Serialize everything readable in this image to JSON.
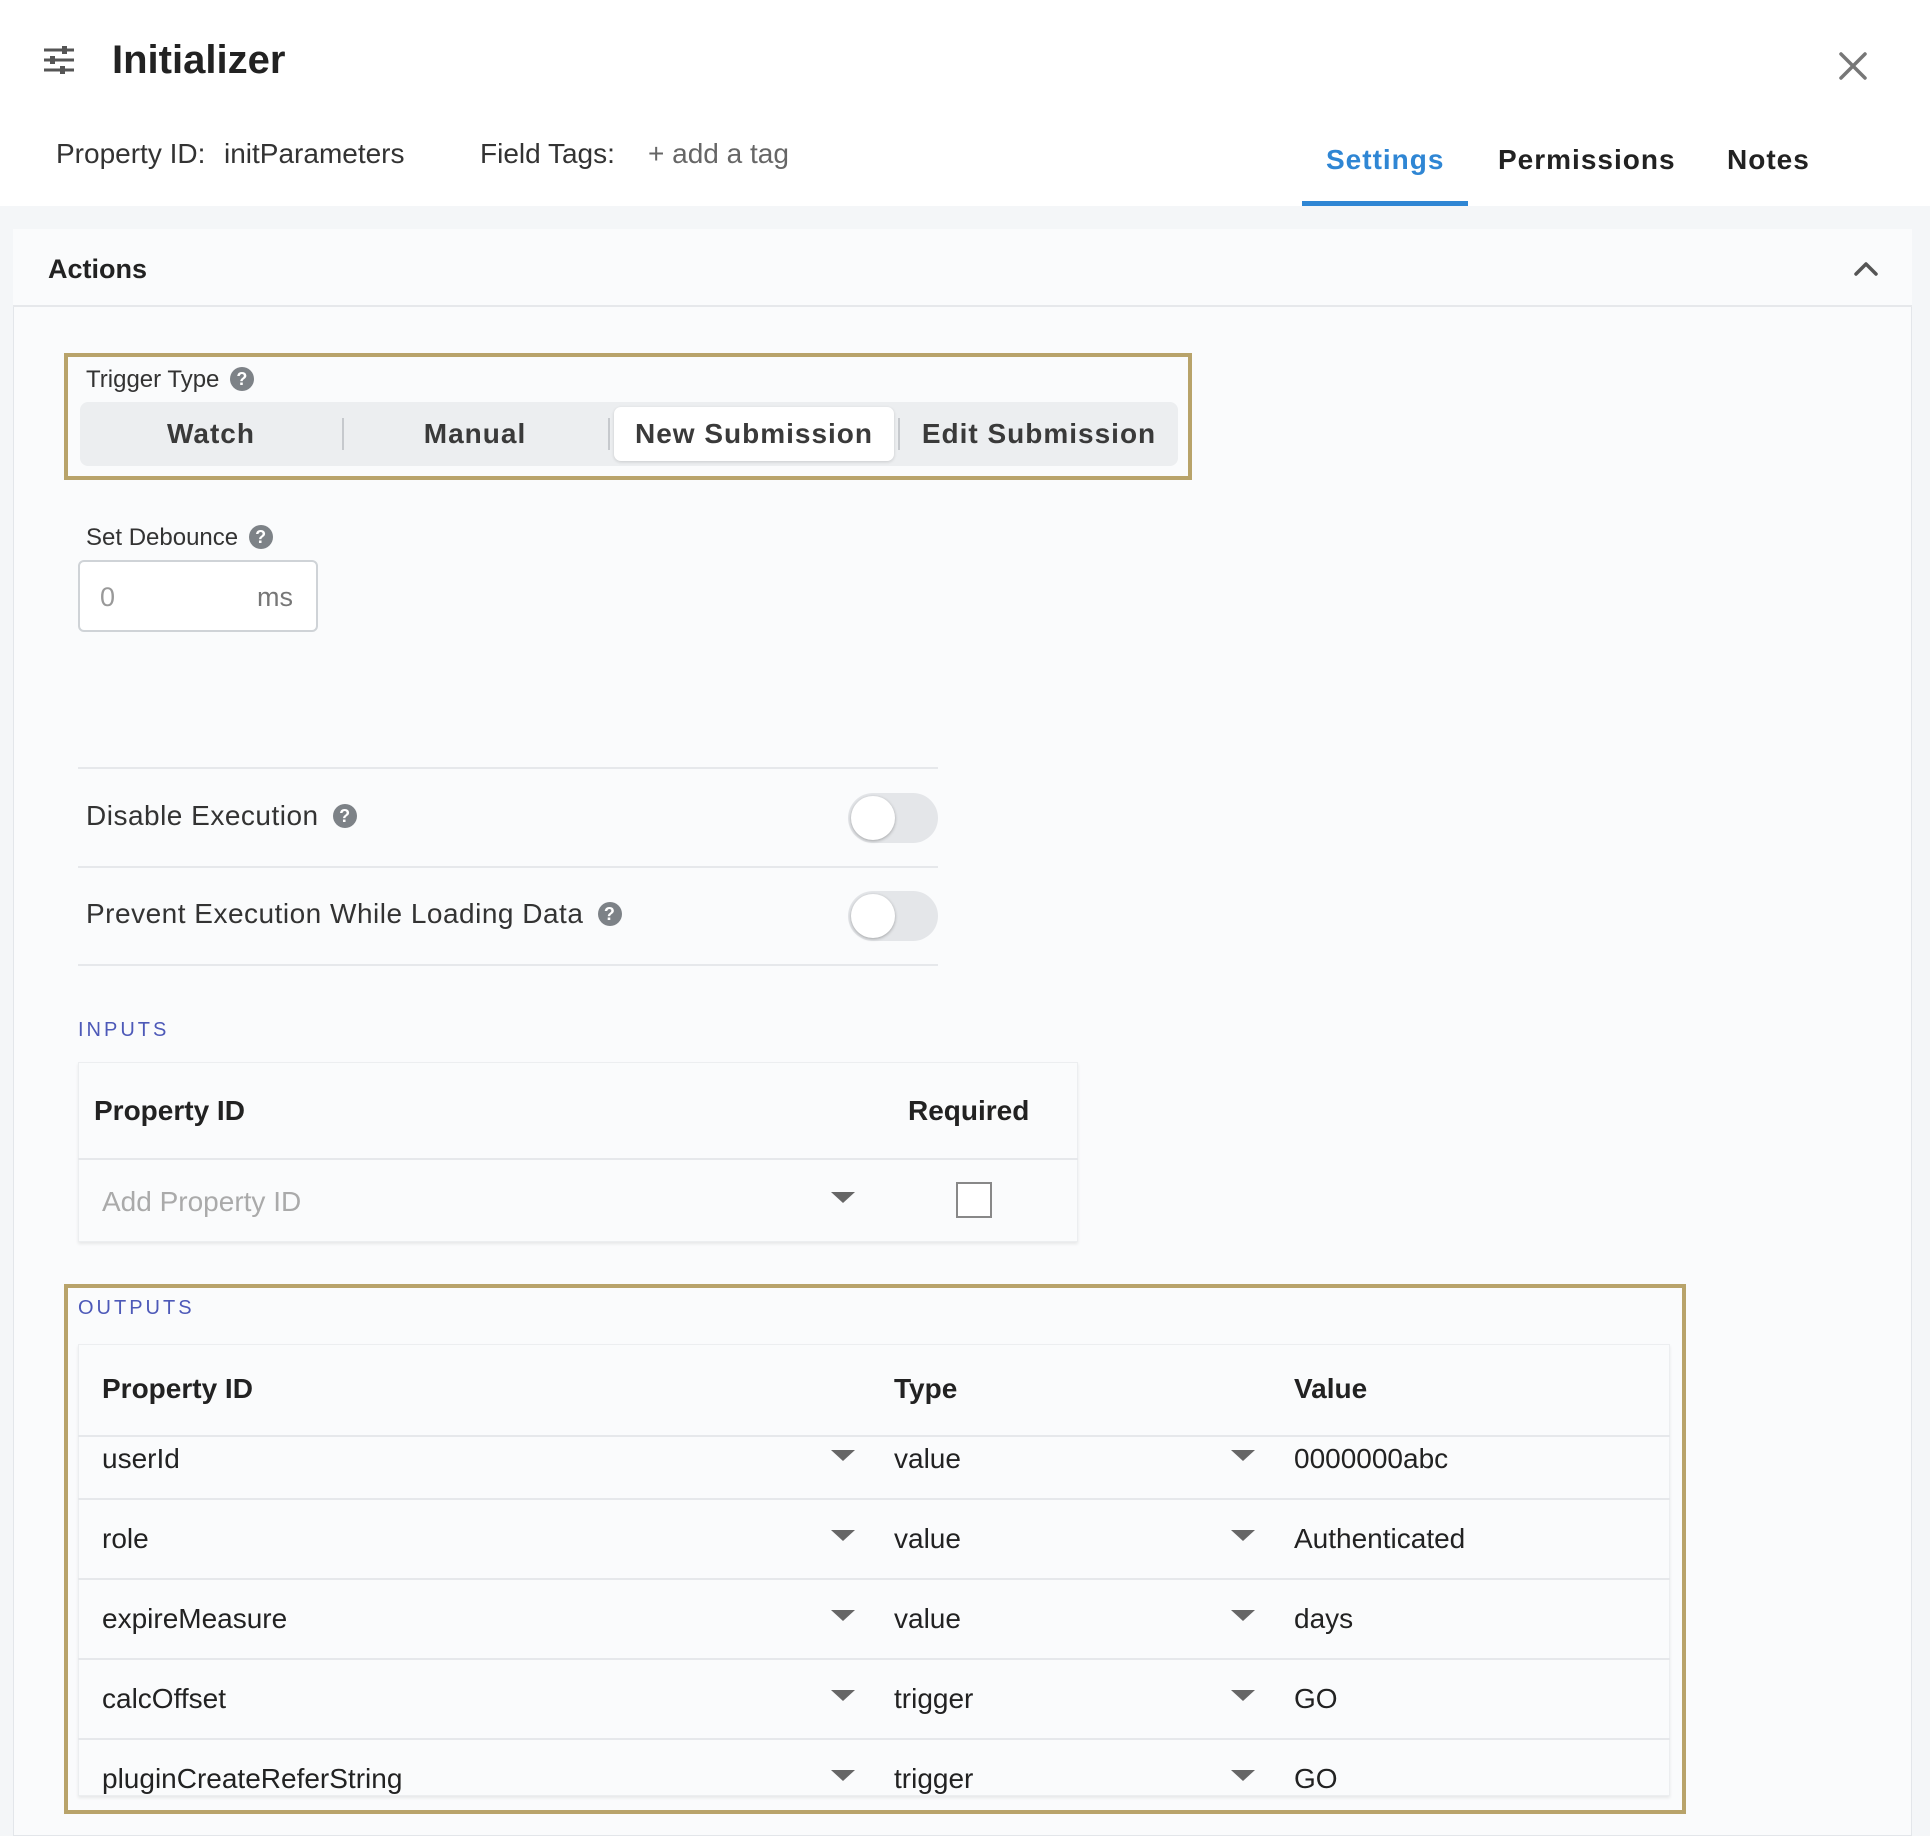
{
  "header": {
    "title": "Initializer",
    "property_id_label": "Property ID:",
    "property_id_value": "initParameters",
    "field_tags_label": "Field Tags:",
    "add_tag_label": "+ add a tag",
    "tabs": [
      {
        "label": "Settings",
        "active": true
      },
      {
        "label": "Permissions",
        "active": false
      },
      {
        "label": "Notes",
        "active": false
      }
    ]
  },
  "actions": {
    "title": "Actions",
    "trigger_type": {
      "label": "Trigger Type",
      "options": [
        "Watch",
        "Manual",
        "New Submission",
        "Edit Submission"
      ],
      "selected": "New Submission"
    },
    "debounce": {
      "label": "Set Debounce",
      "value": "0",
      "unit": "ms"
    },
    "disable_execution": {
      "label": "Disable Execution",
      "on": false
    },
    "prevent_execution": {
      "label": "Prevent Execution While Loading Data",
      "on": false
    }
  },
  "inputs": {
    "section_label": "INPUTS",
    "columns": [
      "Property ID",
      "Required"
    ],
    "placeholder": "Add Property ID",
    "required_checked": false
  },
  "outputs": {
    "section_label": "OUTPUTS",
    "columns": [
      "Property ID",
      "Type",
      "Value"
    ],
    "rows": [
      {
        "property_id": "userId",
        "type": "value",
        "value": "0000000abc"
      },
      {
        "property_id": "role",
        "type": "value",
        "value": "Authenticated"
      },
      {
        "property_id": "expireMeasure",
        "type": "value",
        "value": "days"
      },
      {
        "property_id": "calcOffset",
        "type": "trigger",
        "value": "GO"
      },
      {
        "property_id": "pluginCreateReferString",
        "type": "trigger",
        "value": "GO"
      }
    ]
  },
  "colors": {
    "accent": "#2f86d4",
    "highlight_border": "#b8a36a",
    "section_label": "#4d59b8"
  }
}
